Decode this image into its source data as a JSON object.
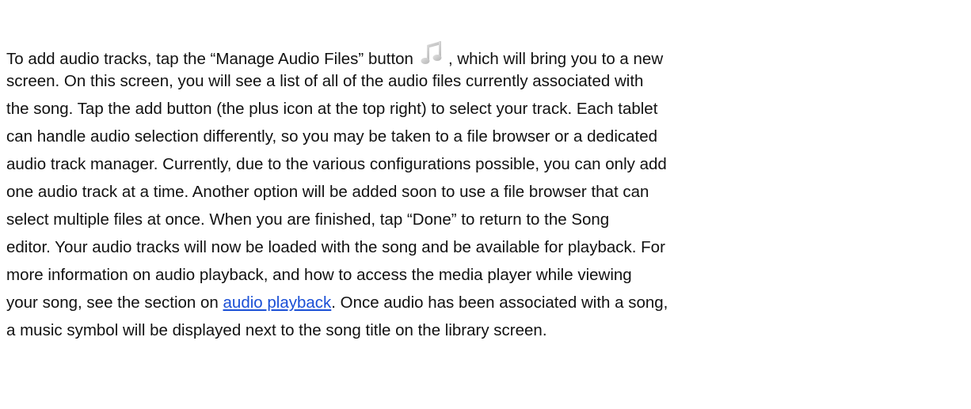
{
  "paragraph": {
    "line1_before_icon": "To add audio tracks, tap the “Manage Audio Files” button",
    "line1_after_icon": ", which will bring you to a new",
    "line2": "screen. On this screen, you will see a list of all of the audio files currently associated with",
    "line3": "the song. Tap the add button (the plus icon at the top right) to select your track. Each tablet",
    "line4": "can handle audio selection differently, so you may be taken to a file browser or a dedicated",
    "line5": "audio track manager. Currently, due to the various configurations possible, you can only add",
    "line6": "one audio track at a time. Another option will be added soon to use a file browser that can",
    "line7": "select multiple files at once.  When you are finished, tap “Done” to return to the Song",
    "line8": "editor. Your audio tracks will now be loaded with the song and be available for playback. For",
    "line9": "more information on audio playback, and how to access the media player while viewing",
    "line10_before_link": "your song, see the section on ",
    "link_text": "audio playback",
    "line10_after_link": ".  Once audio has been associated with a song,",
    "line11": "a music symbol will be displayed next to the song title on the library screen."
  },
  "icons": {
    "manage_audio_icon": "music-note-icon"
  },
  "colors": {
    "text": "#111111",
    "link": "#1a4fd6",
    "icon": "#c9c9c9"
  }
}
